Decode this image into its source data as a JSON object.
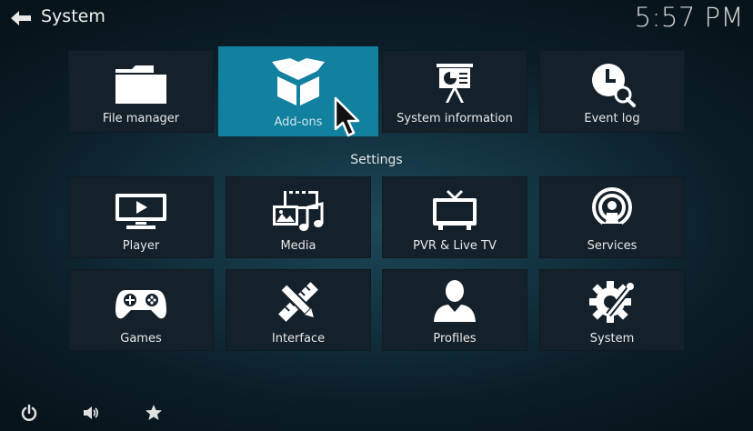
{
  "header": {
    "title": "System",
    "clock": "5:57 PM"
  },
  "top_tiles": [
    {
      "label": "File manager",
      "icon": "folder-icon"
    },
    {
      "label": "Add-ons",
      "icon": "box-icon",
      "focused": true
    },
    {
      "label": "System information",
      "icon": "presentation-icon"
    },
    {
      "label": "Event log",
      "icon": "clock-search-icon"
    }
  ],
  "settings_heading": "Settings",
  "settings_tiles": [
    {
      "label": "Player",
      "icon": "play-screen-icon"
    },
    {
      "label": "Media",
      "icon": "media-icon"
    },
    {
      "label": "PVR & Live TV",
      "icon": "tv-icon"
    },
    {
      "label": "Services",
      "icon": "broadcast-icon"
    },
    {
      "label": "Games",
      "icon": "gamepad-icon"
    },
    {
      "label": "Interface",
      "icon": "ruler-pencil-icon"
    },
    {
      "label": "Profiles",
      "icon": "user-icon"
    },
    {
      "label": "System",
      "icon": "gear-tools-icon"
    }
  ],
  "footer": [
    "power-icon",
    "volume-icon",
    "star-icon"
  ],
  "colors": {
    "focus": "#12809f",
    "tile": "#15212a"
  }
}
